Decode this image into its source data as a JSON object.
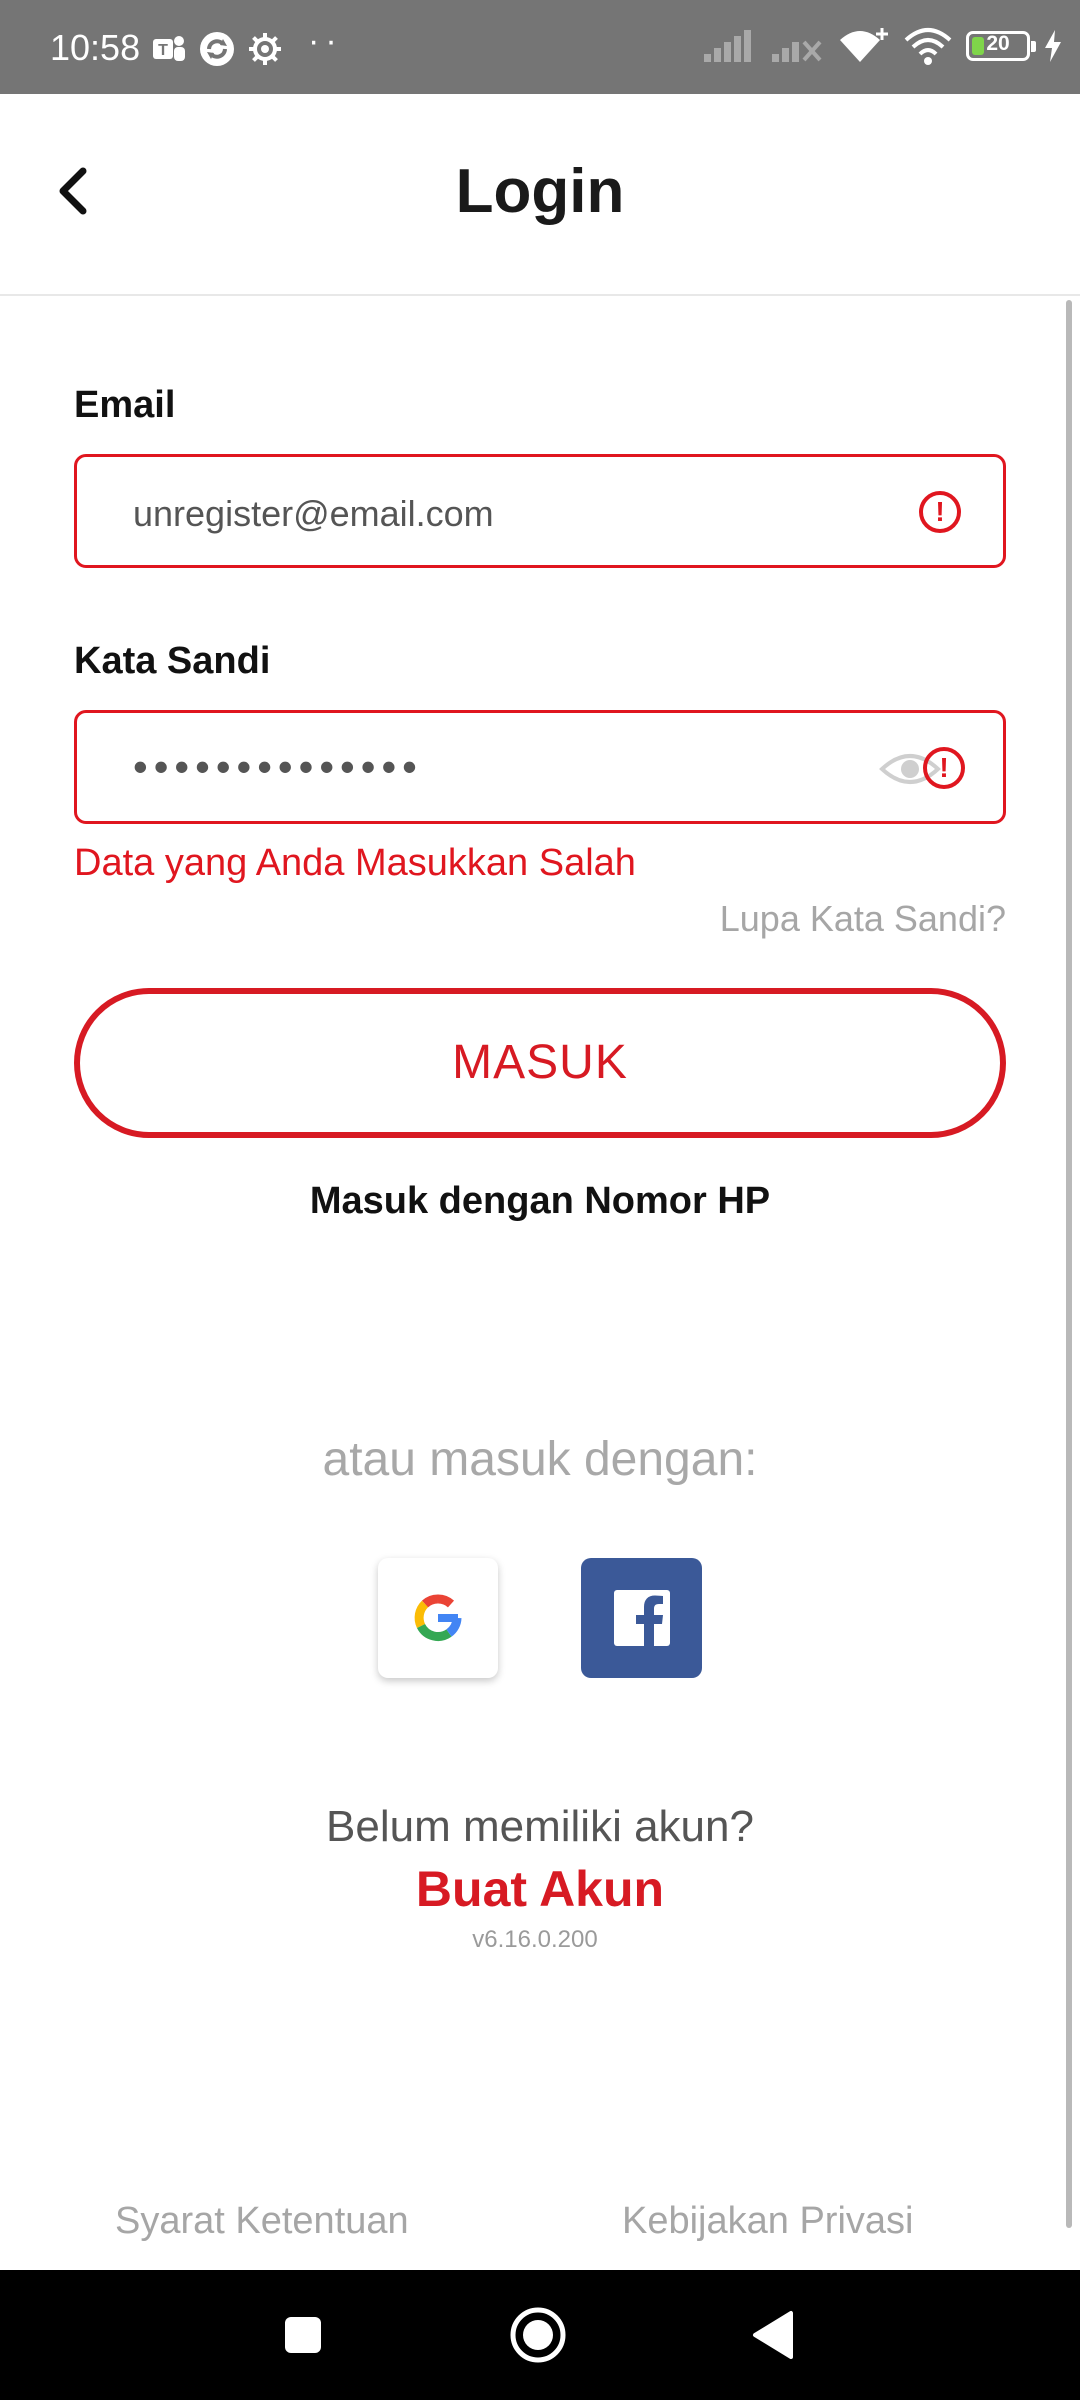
{
  "status_bar": {
    "time": "10:58",
    "dots": "··",
    "battery_level": "20",
    "icons": [
      "teams-icon",
      "sync-icon",
      "settings-gear-icon",
      "signal-icon",
      "signal-no-service-icon",
      "wifi-plus-icon",
      "wifi-icon",
      "battery-icon",
      "charging-icon"
    ]
  },
  "header": {
    "title": "Login",
    "back_icon": "chevron-left-icon"
  },
  "form": {
    "email_label": "Email",
    "email_value": "unregister@email.com",
    "password_label": "Kata Sandi",
    "password_value": "••••••••••••••",
    "error_message": "Data yang Anda Masukkan Salah",
    "error_icon_glyph": "!",
    "forgot_password": "Lupa Kata Sandi?",
    "submit_label": "MASUK",
    "phone_login": "Masuk dengan Nomor HP"
  },
  "social": {
    "caption": "atau masuk dengan:",
    "providers": [
      "google",
      "facebook"
    ]
  },
  "signup": {
    "prompt": "Belum memiliki akun?",
    "link": "Buat Akun",
    "version": "v6.16.0.200"
  },
  "footer": {
    "terms": "Syarat Ketentuan",
    "privacy": "Kebijakan Privasi"
  },
  "colors": {
    "accent": "#d71a23",
    "error": "#e0161f",
    "status_bar": "#757575",
    "facebook": "#3b5998",
    "muted": "#a6a6a6"
  }
}
